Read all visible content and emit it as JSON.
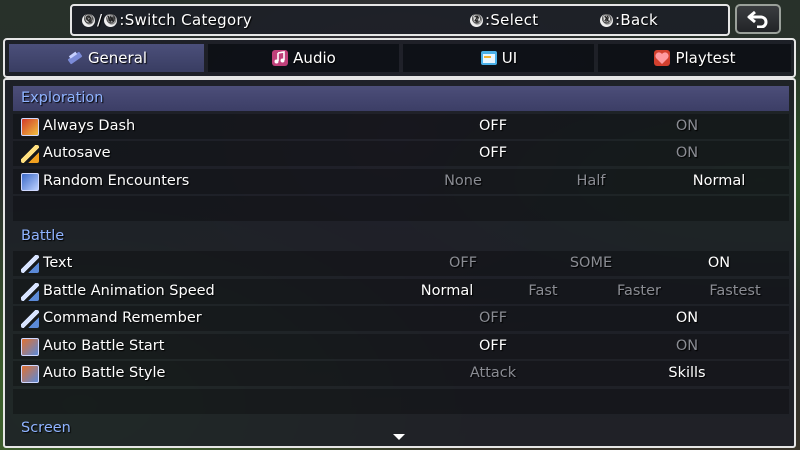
{
  "help": {
    "switch_glyphs": [
      "Ⓠ",
      "Ⓦ"
    ],
    "switch_label": ":Switch Category",
    "select_glyph": "Ⓩ",
    "select_label": ":Select",
    "back_glyph": "Ⓧ",
    "back_label": ":Back"
  },
  "back_button": {
    "icon": "return-arrow-icon"
  },
  "tabs": [
    {
      "label": "General",
      "icon": "gear-icon",
      "active": true
    },
    {
      "label": "Audio",
      "icon": "music-note-icon",
      "active": false
    },
    {
      "label": "UI",
      "icon": "window-icon",
      "active": false
    },
    {
      "label": "Playtest",
      "icon": "heart-icon",
      "active": false
    }
  ],
  "rows": [
    {
      "type": "category",
      "label": "Exploration",
      "selected": true
    },
    {
      "type": "item",
      "label": "Always Dash",
      "icon": "boots-icon",
      "options": [
        "OFF",
        "ON"
      ],
      "selected": 0
    },
    {
      "type": "item",
      "label": "Autosave",
      "icon": "quill-icon",
      "options": [
        "OFF",
        "ON"
      ],
      "selected": 0
    },
    {
      "type": "item",
      "label": "Random Encounters",
      "icon": "encounter-icon",
      "options": [
        "None",
        "Half",
        "Normal"
      ],
      "selected": 2
    },
    {
      "type": "spacer"
    },
    {
      "type": "category",
      "label": "Battle",
      "selected": false
    },
    {
      "type": "item",
      "label": "Text",
      "icon": "sword-icon",
      "options": [
        "OFF",
        "SOME",
        "ON"
      ],
      "selected": 2
    },
    {
      "type": "item",
      "label": "Battle Animation Speed",
      "icon": "sword-icon",
      "options": [
        "Normal",
        "Fast",
        "Faster",
        "Fastest"
      ],
      "selected": 0
    },
    {
      "type": "item",
      "label": "Command Remember",
      "icon": "sword-icon",
      "options": [
        "OFF",
        "ON"
      ],
      "selected": 1
    },
    {
      "type": "item",
      "label": "Auto Battle Start",
      "icon": "auto-battle-icon",
      "options": [
        "OFF",
        "ON"
      ],
      "selected": 0
    },
    {
      "type": "item",
      "label": "Auto Battle Style",
      "icon": "auto-battle-icon",
      "options": [
        "Attack",
        "Skills"
      ],
      "selected": 1
    },
    {
      "type": "spacer"
    },
    {
      "type": "category",
      "label": "Screen",
      "selected": false
    }
  ],
  "colors": {
    "category_text": "#8fb3ff",
    "selected_option": "#ffffff",
    "unselected_option": "#8a8c93",
    "highlight": "#4c4e79"
  }
}
